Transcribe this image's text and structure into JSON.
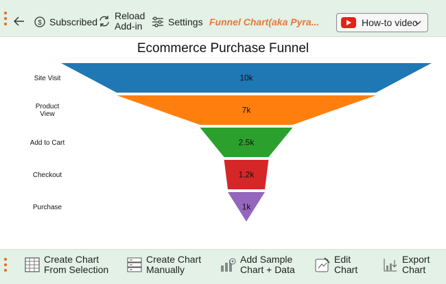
{
  "top_toolbar": {
    "subscribed_label": "Subscribed",
    "reload_label_line1": "Reload",
    "reload_label_line2": "Add-in",
    "settings_label": "Settings",
    "brand_label": "Funnel Chart(aka Pyra...",
    "howto_label": "How-to video"
  },
  "bottom_toolbar": {
    "create_selection_line1": "Create Chart",
    "create_selection_line2": "From Selection",
    "create_manual_line1": "Create Chart",
    "create_manual_line2": "Manually",
    "add_sample_line1": "Add Sample",
    "add_sample_line2": "Chart + Data",
    "edit_line1": "Edit",
    "edit_line2": "Chart",
    "export_line1": "Export",
    "export_line2": "Chart"
  },
  "chart_data": {
    "type": "funnel",
    "title": "Ecommerce Purchase Funnel",
    "stages": [
      {
        "label": "Site Visit",
        "value": 10000,
        "display": "10k",
        "color": "#1f77b4"
      },
      {
        "label": "Product View",
        "value": 7000,
        "display": "7k",
        "color": "#ff7f0e"
      },
      {
        "label": "Add to Cart",
        "value": 2500,
        "display": "2.5k",
        "color": "#2ca02c"
      },
      {
        "label": "Checkout",
        "value": 1200,
        "display": "1.2k",
        "color": "#d62728"
      },
      {
        "label": "Purchase",
        "value": 1000,
        "display": "1k",
        "color": "#9467bd"
      }
    ]
  }
}
